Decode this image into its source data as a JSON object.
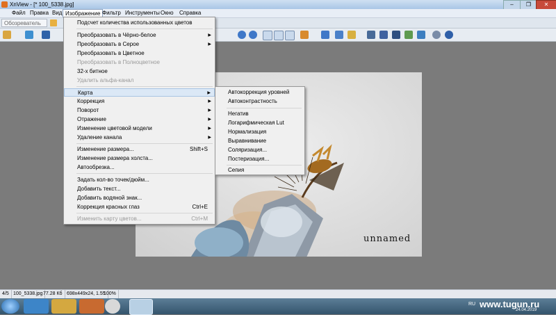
{
  "window": {
    "title": "XnView - [* 100_5338.jpg]",
    "btn_min": "–",
    "btn_max": "❐",
    "btn_close": "✕"
  },
  "menubar": [
    "Файл",
    "Правка",
    "Вид",
    "Изображение",
    "Фильтр",
    "Инструменты",
    "Окно",
    "Справка"
  ],
  "tabs": {
    "browser": "Обозреватель"
  },
  "image_menu": {
    "items": [
      {
        "label": "Подсчет количества использованных цветов"
      },
      {
        "label": "Преобразовать в Чёрно-белое",
        "arrow": true
      },
      {
        "label": "Преобразовать в Серое",
        "arrow": true
      },
      {
        "label": "Преобразовать в Цветное"
      },
      {
        "label": "Преобразовать в Полноцветное",
        "disabled": true
      },
      {
        "label": "32-х битное"
      },
      {
        "label": "Удалить альфа-канал",
        "disabled": true
      },
      {
        "label": "Карта",
        "arrow": true,
        "highlight": true
      },
      {
        "label": "Коррекция",
        "arrow": true
      },
      {
        "label": "Поворот",
        "arrow": true
      },
      {
        "label": "Отражение",
        "arrow": true
      },
      {
        "label": "Изменение цветовой модели",
        "arrow": true
      },
      {
        "label": "Удаление канала",
        "arrow": true
      },
      {
        "label": "Изменение размера...",
        "shortcut": "Shift+S"
      },
      {
        "label": "Изменение размера холста..."
      },
      {
        "label": "Автообрезка..."
      },
      {
        "label": "Задать кол-во точек/дюйм..."
      },
      {
        "label": "Добавить текст..."
      },
      {
        "label": "Добавить водяной знак..."
      },
      {
        "label": "Коррекция красных глаз",
        "shortcut": "Ctrl+E"
      },
      {
        "label": "Изменить карту цветов...",
        "shortcut": "Ctrl+M",
        "disabled": true
      }
    ]
  },
  "map_submenu": {
    "items": [
      {
        "label": "Автокоррекция уровней"
      },
      {
        "label": "Автоконтрастность"
      },
      {
        "label": "Негатив"
      },
      {
        "label": "Логарифмическая Lut"
      },
      {
        "label": "Нормализация"
      },
      {
        "label": "Выравнивание"
      },
      {
        "label": "Соляризация..."
      },
      {
        "label": "Постеризация..."
      },
      {
        "label": "Сепия"
      }
    ]
  },
  "photo": {
    "watermark": "unnamed"
  },
  "statusbar": {
    "index": "4/5",
    "filename": "100_5338.jpg",
    "size": "77.28 Кб",
    "dims": "698x449x24, 1.55",
    "zoom": "100%"
  },
  "taskbar": {
    "lang": "RU",
    "url": "www.tugun.ru",
    "date": "24.04.2019"
  },
  "colors": {
    "accent": "#dbe8f6",
    "menu_bg": "#f0f0f0",
    "workspace": "#7b7b7b"
  }
}
